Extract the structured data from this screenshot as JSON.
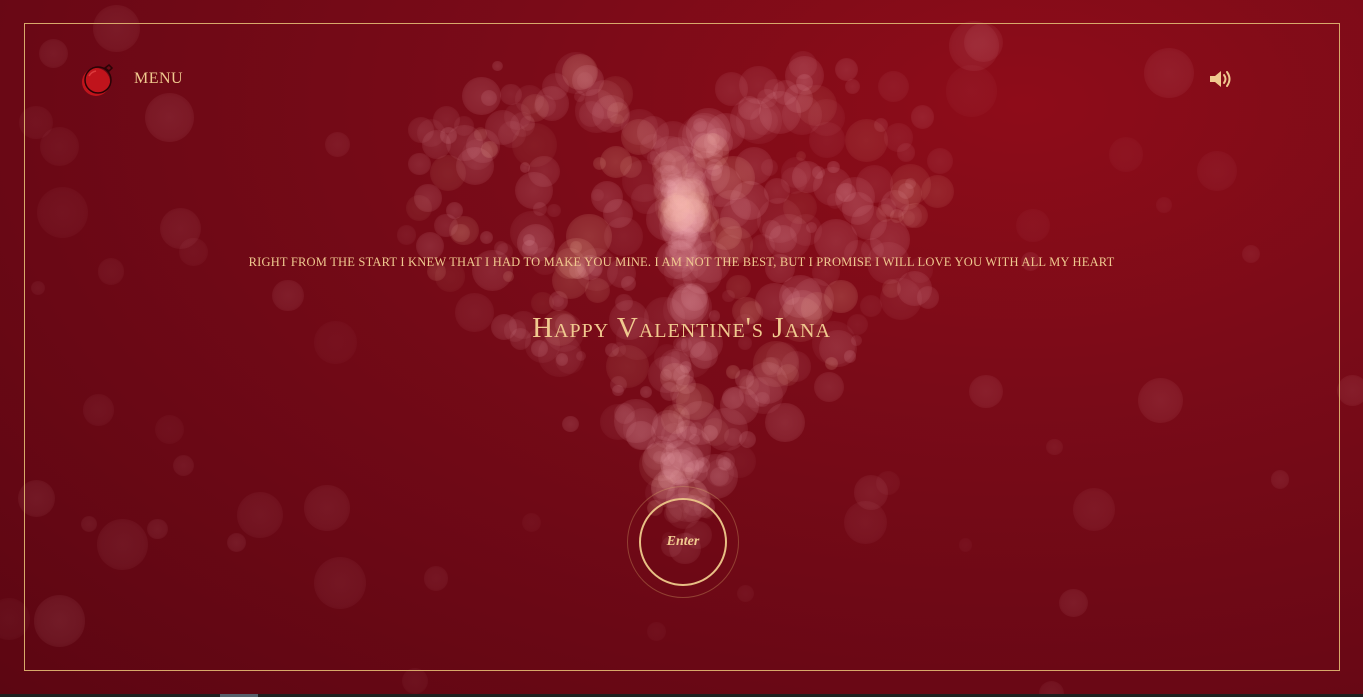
{
  "header": {
    "menu_label": "MENU",
    "logo_icon": "ornament-ball-icon",
    "sound_icon": "speaker-volume-icon"
  },
  "main": {
    "message": "RIGHT FROM THE START I KNEW THAT I HAD TO MAKE YOU MINE. I AM NOT THE BEST, BUT I PROMISE I WILL LOVE YOU WITH ALL MY HEART",
    "greeting": "Happy Valentine's Jana",
    "enter_label": "Enter"
  },
  "colors": {
    "background": "#7a0b18",
    "accent_gold": "#f0c98f",
    "frame_border": "#d8a96a"
  }
}
